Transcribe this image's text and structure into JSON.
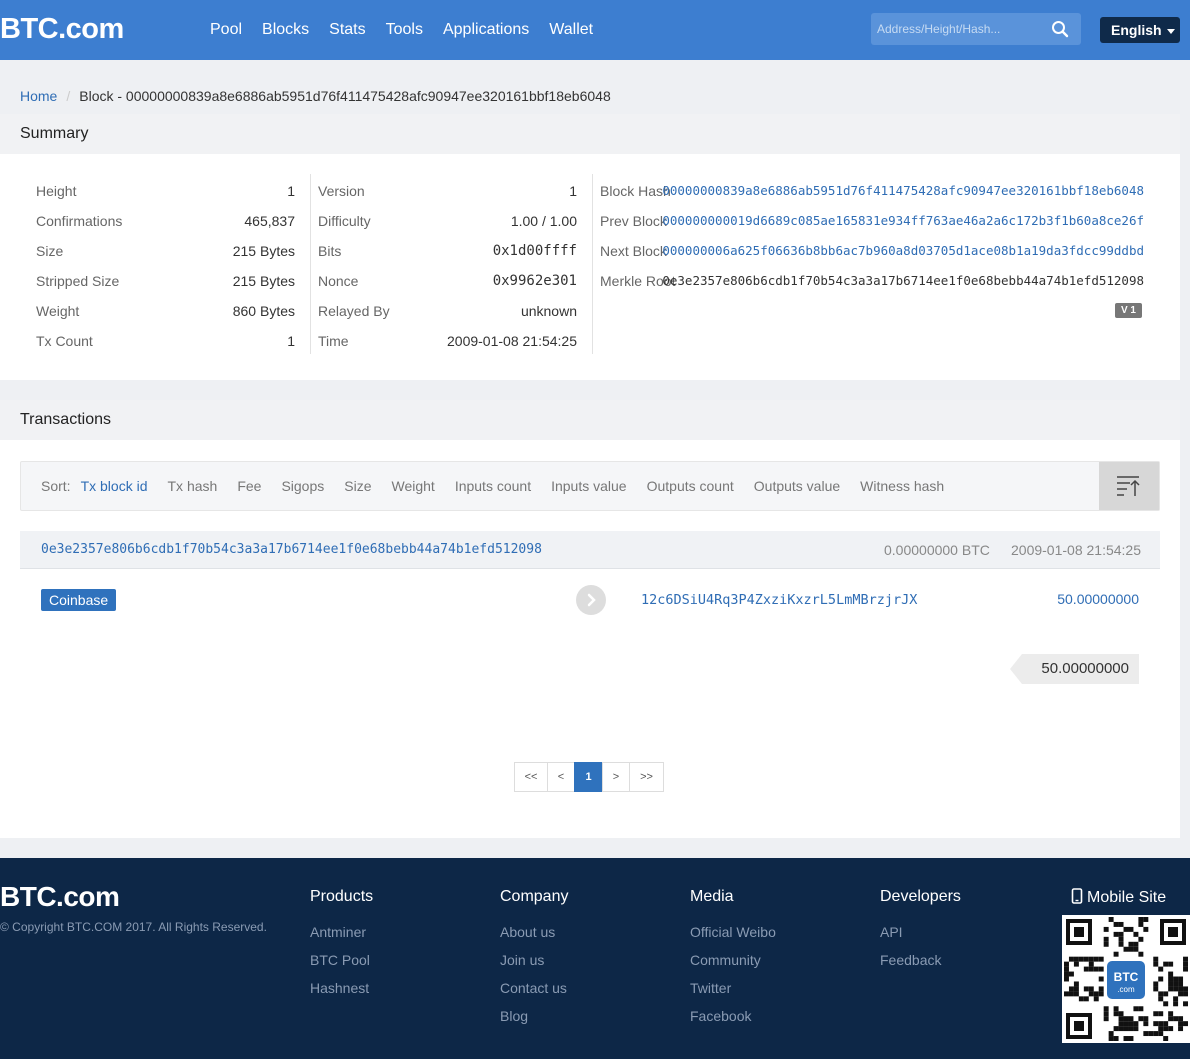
{
  "nav": {
    "logo": "BTC.com",
    "links": [
      "Pool",
      "Blocks",
      "Stats",
      "Tools",
      "Applications",
      "Wallet"
    ],
    "search_placeholder": "Address/Height/Hash...",
    "language": "English"
  },
  "breadcrumb": {
    "home": "Home",
    "current": "Block - 00000000839a8e6886ab5951d76f411475428afc90947ee320161bbf18eb6048"
  },
  "summary": {
    "title": "Summary",
    "col1": [
      {
        "k": "Height",
        "v": "1"
      },
      {
        "k": "Confirmations",
        "v": "465,837"
      },
      {
        "k": "Size",
        "v": "215 Bytes"
      },
      {
        "k": "Stripped Size",
        "v": "215 Bytes"
      },
      {
        "k": "Weight",
        "v": "860 Bytes"
      },
      {
        "k": "Tx Count",
        "v": "1"
      }
    ],
    "col2": [
      {
        "k": "Version",
        "v": "1"
      },
      {
        "k": "Difficulty",
        "v": "1.00 / 1.00"
      },
      {
        "k": "Bits",
        "v": "0x1d00ffff"
      },
      {
        "k": "Nonce",
        "v": "0x9962e301"
      },
      {
        "k": "Relayed By",
        "v": "unknown"
      },
      {
        "k": "Time",
        "v": "2009-01-08 21:54:25"
      }
    ],
    "col3": [
      {
        "k": "Block Hash",
        "v": "00000000839a8e6886ab5951d76f411475428afc90947ee320161bbf18eb6048"
      },
      {
        "k": "Prev Block",
        "v": "000000000019d6689c085ae165831e934ff763ae46a2a6c172b3f1b60a8ce26f"
      },
      {
        "k": "Next Block",
        "v": "000000006a625f06636b8bb6ac7b960a8d03705d1ace08b1a19da3fdcc99ddbd"
      },
      {
        "k": "Merkle Root",
        "v": "0e3e2357e806b6cdb1f70b54c3a3a17b6714ee1f0e68bebb44a74b1efd512098"
      }
    ],
    "version_badge": "V 1"
  },
  "transactions": {
    "title": "Transactions",
    "sort_label": "Sort:",
    "sort_options": [
      "Tx block id",
      "Tx hash",
      "Fee",
      "Sigops",
      "Size",
      "Weight",
      "Inputs count",
      "Inputs value",
      "Outputs count",
      "Outputs value",
      "Witness hash"
    ],
    "tx": {
      "hash": "0e3e2357e806b6cdb1f70b54c3a3a17b6714ee1f0e68bebb44a74b1efd512098",
      "fee": "0.00000000 BTC",
      "time": "2009-01-08 21:54:25",
      "input_label": "Coinbase",
      "output_address": "12c6DSiU4Rq3P4ZxziKxzrL5LmMBrzjrJX",
      "output_value": "50.00000000",
      "total": "50.00000000"
    },
    "pager": [
      "<<",
      "<",
      "1",
      ">",
      ">>"
    ]
  },
  "footer": {
    "logo": "BTC.com",
    "copyright": "© Copyright BTC.COM 2017. All Rights Reserved.",
    "columns": [
      {
        "title": "Products",
        "items": [
          "Antminer",
          "BTC Pool",
          "Hashnest"
        ]
      },
      {
        "title": "Company",
        "items": [
          "About us",
          "Join us",
          "Contact us",
          "Blog"
        ]
      },
      {
        "title": "Media",
        "items": [
          "Official Weibo",
          "Community",
          "Twitter",
          "Facebook"
        ]
      },
      {
        "title": "Developers",
        "items": [
          "API",
          "Feedback"
        ]
      }
    ],
    "mobile_site": "Mobile Site",
    "qr_badge_top": "BTC",
    "qr_badge_bottom": ".com"
  },
  "colors": {
    "navbar": "#3d7ed0",
    "link": "#2f6db5",
    "footer": "#0d2747",
    "button_primary": "#2f72bd"
  }
}
